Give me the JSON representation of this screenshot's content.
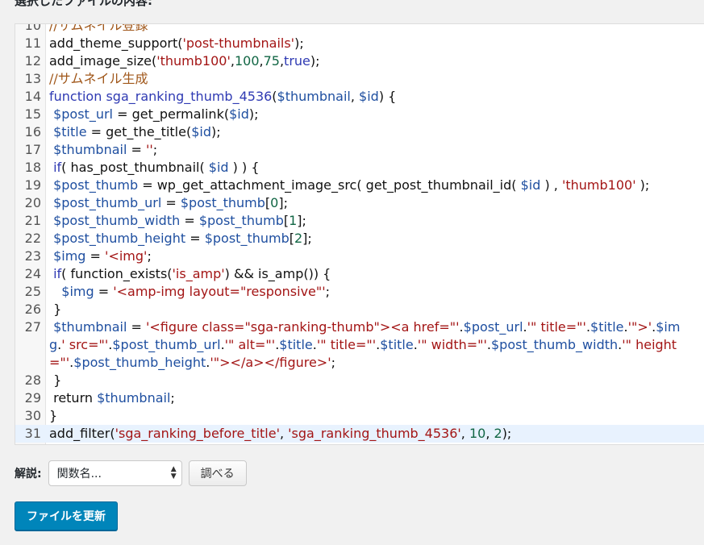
{
  "header": {
    "title": "選択したファイルの内容:"
  },
  "editor": {
    "lines": [
      {
        "num": "10",
        "tokens": [
          {
            "t": "//サムネイル登録",
            "c": "c"
          }
        ]
      },
      {
        "num": "11",
        "tokens": [
          {
            "t": "add_theme_support(",
            "c": "p"
          },
          {
            "t": "'post-thumbnails'",
            "c": "s"
          },
          {
            "t": ");",
            "c": "p"
          }
        ]
      },
      {
        "num": "12",
        "tokens": [
          {
            "t": "add_image_size(",
            "c": "p"
          },
          {
            "t": "'thumb100'",
            "c": "s"
          },
          {
            "t": ",",
            "c": "p"
          },
          {
            "t": "100",
            "c": "n"
          },
          {
            "t": ",",
            "c": "p"
          },
          {
            "t": "75",
            "c": "n"
          },
          {
            "t": ",",
            "c": "p"
          },
          {
            "t": "true",
            "c": "k"
          },
          {
            "t": ");",
            "c": "p"
          }
        ]
      },
      {
        "num": "13",
        "tokens": [
          {
            "t": "//サムネイル生成",
            "c": "c"
          }
        ]
      },
      {
        "num": "14",
        "tokens": [
          {
            "t": "function ",
            "c": "k"
          },
          {
            "t": "sga_ranking_thumb_4536",
            "c": "k"
          },
          {
            "t": "(",
            "c": "p"
          },
          {
            "t": "$thumbnail",
            "c": "v"
          },
          {
            "t": ", ",
            "c": "p"
          },
          {
            "t": "$id",
            "c": "v"
          },
          {
            "t": ") {",
            "c": "p"
          }
        ]
      },
      {
        "num": "15",
        "tokens": [
          {
            "t": " ",
            "c": "p"
          },
          {
            "t": "$post_url",
            "c": "v"
          },
          {
            "t": " = get_permalink(",
            "c": "p"
          },
          {
            "t": "$id",
            "c": "v"
          },
          {
            "t": ");",
            "c": "p"
          }
        ]
      },
      {
        "num": "16",
        "tokens": [
          {
            "t": " ",
            "c": "p"
          },
          {
            "t": "$title",
            "c": "v"
          },
          {
            "t": " = get_the_title(",
            "c": "p"
          },
          {
            "t": "$id",
            "c": "v"
          },
          {
            "t": ");",
            "c": "p"
          }
        ]
      },
      {
        "num": "17",
        "tokens": [
          {
            "t": " ",
            "c": "p"
          },
          {
            "t": "$thumbnail",
            "c": "v"
          },
          {
            "t": " = ",
            "c": "p"
          },
          {
            "t": "''",
            "c": "s"
          },
          {
            "t": ";",
            "c": "p"
          }
        ]
      },
      {
        "num": "18",
        "tokens": [
          {
            "t": " ",
            "c": "p"
          },
          {
            "t": "if",
            "c": "k"
          },
          {
            "t": "( has_post_thumbnail( ",
            "c": "p"
          },
          {
            "t": "$id",
            "c": "v"
          },
          {
            "t": " ) ) {",
            "c": "p"
          }
        ]
      },
      {
        "num": "19",
        "tokens": [
          {
            "t": " ",
            "c": "p"
          },
          {
            "t": "$post_thumb",
            "c": "v"
          },
          {
            "t": " = wp_get_attachment_image_src( get_post_thumbnail_id( ",
            "c": "p"
          },
          {
            "t": "$id",
            "c": "v"
          },
          {
            "t": " ) , ",
            "c": "p"
          },
          {
            "t": "'thumb100'",
            "c": "s"
          },
          {
            "t": " );",
            "c": "p"
          }
        ]
      },
      {
        "num": "20",
        "tokens": [
          {
            "t": " ",
            "c": "p"
          },
          {
            "t": "$post_thumb_url",
            "c": "v"
          },
          {
            "t": " = ",
            "c": "p"
          },
          {
            "t": "$post_thumb",
            "c": "v"
          },
          {
            "t": "[",
            "c": "p"
          },
          {
            "t": "0",
            "c": "n"
          },
          {
            "t": "];",
            "c": "p"
          }
        ]
      },
      {
        "num": "21",
        "tokens": [
          {
            "t": " ",
            "c": "p"
          },
          {
            "t": "$post_thumb_width",
            "c": "v"
          },
          {
            "t": " = ",
            "c": "p"
          },
          {
            "t": "$post_thumb",
            "c": "v"
          },
          {
            "t": "[",
            "c": "p"
          },
          {
            "t": "1",
            "c": "n"
          },
          {
            "t": "];",
            "c": "p"
          }
        ]
      },
      {
        "num": "22",
        "tokens": [
          {
            "t": " ",
            "c": "p"
          },
          {
            "t": "$post_thumb_height",
            "c": "v"
          },
          {
            "t": " = ",
            "c": "p"
          },
          {
            "t": "$post_thumb",
            "c": "v"
          },
          {
            "t": "[",
            "c": "p"
          },
          {
            "t": "2",
            "c": "n"
          },
          {
            "t": "];",
            "c": "p"
          }
        ]
      },
      {
        "num": "23",
        "tokens": [
          {
            "t": " ",
            "c": "p"
          },
          {
            "t": "$img",
            "c": "v"
          },
          {
            "t": " = ",
            "c": "p"
          },
          {
            "t": "'<img'",
            "c": "s"
          },
          {
            "t": ";",
            "c": "p"
          }
        ]
      },
      {
        "num": "24",
        "tokens": [
          {
            "t": " ",
            "c": "p"
          },
          {
            "t": "if",
            "c": "k"
          },
          {
            "t": "( function_exists(",
            "c": "p"
          },
          {
            "t": "'is_amp'",
            "c": "s"
          },
          {
            "t": ") && is_amp()) {",
            "c": "p"
          }
        ]
      },
      {
        "num": "25",
        "tokens": [
          {
            "t": "   ",
            "c": "p"
          },
          {
            "t": "$img",
            "c": "v"
          },
          {
            "t": " = ",
            "c": "p"
          },
          {
            "t": "'<amp-img layout=\"responsive\"'",
            "c": "s"
          },
          {
            "t": ";",
            "c": "p"
          }
        ]
      },
      {
        "num": "26",
        "tokens": [
          {
            "t": " }",
            "c": "p"
          }
        ]
      },
      {
        "num": "27",
        "wrap": true,
        "tokens": [
          {
            "t": " ",
            "c": "p"
          },
          {
            "t": "$thumbnail",
            "c": "v"
          },
          {
            "t": " = ",
            "c": "p"
          },
          {
            "t": "'<figure class=\"sga-ranking-thumb\"><a href=\"'",
            "c": "s"
          },
          {
            "t": ".",
            "c": "p"
          },
          {
            "t": "$post_url",
            "c": "v"
          },
          {
            "t": ".",
            "c": "p"
          },
          {
            "t": "'\" title=\"'",
            "c": "s"
          },
          {
            "t": ".",
            "c": "p"
          },
          {
            "t": "$title",
            "c": "v"
          },
          {
            "t": ".",
            "c": "p"
          },
          {
            "t": "'\">'",
            "c": "s"
          },
          {
            "t": ".",
            "c": "p"
          },
          {
            "t": "$img",
            "c": "v"
          },
          {
            "t": ".",
            "c": "p"
          },
          {
            "t": "' src=\"'",
            "c": "s"
          },
          {
            "t": ".",
            "c": "p"
          },
          {
            "t": "$post_thumb_url",
            "c": "v"
          },
          {
            "t": ".",
            "c": "p"
          },
          {
            "t": "'\" alt=\"'",
            "c": "s"
          },
          {
            "t": ".",
            "c": "p"
          },
          {
            "t": "$title",
            "c": "v"
          },
          {
            "t": ".",
            "c": "p"
          },
          {
            "t": "'\" title=\"'",
            "c": "s"
          },
          {
            "t": ".",
            "c": "p"
          },
          {
            "t": "$title",
            "c": "v"
          },
          {
            "t": ".",
            "c": "p"
          },
          {
            "t": "'\" width=\"'",
            "c": "s"
          },
          {
            "t": ".",
            "c": "p"
          },
          {
            "t": "$post_thumb_width",
            "c": "v"
          },
          {
            "t": ".",
            "c": "p"
          },
          {
            "t": "'\" height=\"'",
            "c": "s"
          },
          {
            "t": ".",
            "c": "p"
          },
          {
            "t": "$post_thumb_height",
            "c": "v"
          },
          {
            "t": ".",
            "c": "p"
          },
          {
            "t": "'\"></a></figure>'",
            "c": "s"
          },
          {
            "t": ";",
            "c": "p"
          }
        ]
      },
      {
        "num": "28",
        "tokens": [
          {
            "t": " }",
            "c": "p"
          }
        ]
      },
      {
        "num": "29",
        "tokens": [
          {
            "t": " return ",
            "c": "p"
          },
          {
            "t": "$thumbnail",
            "c": "v"
          },
          {
            "t": ";",
            "c": "p"
          }
        ]
      },
      {
        "num": "30",
        "tokens": [
          {
            "t": "}",
            "c": "p"
          }
        ]
      },
      {
        "num": "31",
        "active": true,
        "tokens": [
          {
            "t": "add_filter(",
            "c": "p"
          },
          {
            "t": "'sga_ranking_before_title'",
            "c": "s"
          },
          {
            "t": ", ",
            "c": "p"
          },
          {
            "t": "'sga_ranking_thumb_4536'",
            "c": "s"
          },
          {
            "t": ", ",
            "c": "p"
          },
          {
            "t": "10",
            "c": "n"
          },
          {
            "t": ", ",
            "c": "p"
          },
          {
            "t": "2",
            "c": "n"
          },
          {
            "t": ");",
            "c": "p"
          }
        ]
      }
    ]
  },
  "doc": {
    "label": "解説:",
    "select_value": "関数名...",
    "lookup_button": "調べる"
  },
  "update_button": "ファイルを更新",
  "colors": {
    "primary": "#0085ba",
    "string": "#a31515",
    "keyword": "#2f3ab3",
    "comment": "#a0571a",
    "number": "#116644"
  }
}
